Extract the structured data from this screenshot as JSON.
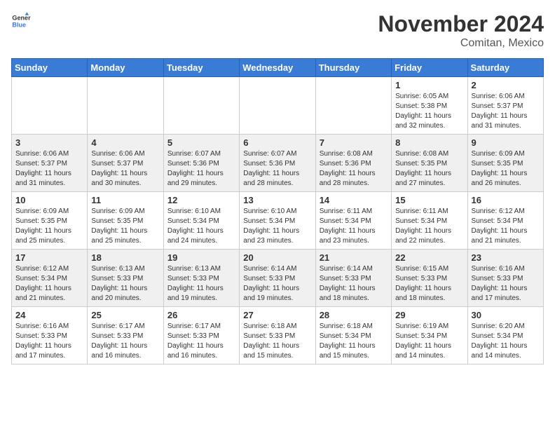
{
  "header": {
    "logo_general": "General",
    "logo_blue": "Blue",
    "month_title": "November 2024",
    "subtitle": "Comitan, Mexico"
  },
  "days_of_week": [
    "Sunday",
    "Monday",
    "Tuesday",
    "Wednesday",
    "Thursday",
    "Friday",
    "Saturday"
  ],
  "weeks": [
    {
      "days": [
        {
          "date": "",
          "info": ""
        },
        {
          "date": "",
          "info": ""
        },
        {
          "date": "",
          "info": ""
        },
        {
          "date": "",
          "info": ""
        },
        {
          "date": "",
          "info": ""
        },
        {
          "date": "1",
          "info": "Sunrise: 6:05 AM\nSunset: 5:38 PM\nDaylight: 11 hours\nand 32 minutes."
        },
        {
          "date": "2",
          "info": "Sunrise: 6:06 AM\nSunset: 5:37 PM\nDaylight: 11 hours\nand 31 minutes."
        }
      ]
    },
    {
      "days": [
        {
          "date": "3",
          "info": "Sunrise: 6:06 AM\nSunset: 5:37 PM\nDaylight: 11 hours\nand 31 minutes."
        },
        {
          "date": "4",
          "info": "Sunrise: 6:06 AM\nSunset: 5:37 PM\nDaylight: 11 hours\nand 30 minutes."
        },
        {
          "date": "5",
          "info": "Sunrise: 6:07 AM\nSunset: 5:36 PM\nDaylight: 11 hours\nand 29 minutes."
        },
        {
          "date": "6",
          "info": "Sunrise: 6:07 AM\nSunset: 5:36 PM\nDaylight: 11 hours\nand 28 minutes."
        },
        {
          "date": "7",
          "info": "Sunrise: 6:08 AM\nSunset: 5:36 PM\nDaylight: 11 hours\nand 28 minutes."
        },
        {
          "date": "8",
          "info": "Sunrise: 6:08 AM\nSunset: 5:35 PM\nDaylight: 11 hours\nand 27 minutes."
        },
        {
          "date": "9",
          "info": "Sunrise: 6:09 AM\nSunset: 5:35 PM\nDaylight: 11 hours\nand 26 minutes."
        }
      ]
    },
    {
      "days": [
        {
          "date": "10",
          "info": "Sunrise: 6:09 AM\nSunset: 5:35 PM\nDaylight: 11 hours\nand 25 minutes."
        },
        {
          "date": "11",
          "info": "Sunrise: 6:09 AM\nSunset: 5:35 PM\nDaylight: 11 hours\nand 25 minutes."
        },
        {
          "date": "12",
          "info": "Sunrise: 6:10 AM\nSunset: 5:34 PM\nDaylight: 11 hours\nand 24 minutes."
        },
        {
          "date": "13",
          "info": "Sunrise: 6:10 AM\nSunset: 5:34 PM\nDaylight: 11 hours\nand 23 minutes."
        },
        {
          "date": "14",
          "info": "Sunrise: 6:11 AM\nSunset: 5:34 PM\nDaylight: 11 hours\nand 23 minutes."
        },
        {
          "date": "15",
          "info": "Sunrise: 6:11 AM\nSunset: 5:34 PM\nDaylight: 11 hours\nand 22 minutes."
        },
        {
          "date": "16",
          "info": "Sunrise: 6:12 AM\nSunset: 5:34 PM\nDaylight: 11 hours\nand 21 minutes."
        }
      ]
    },
    {
      "days": [
        {
          "date": "17",
          "info": "Sunrise: 6:12 AM\nSunset: 5:34 PM\nDaylight: 11 hours\nand 21 minutes."
        },
        {
          "date": "18",
          "info": "Sunrise: 6:13 AM\nSunset: 5:33 PM\nDaylight: 11 hours\nand 20 minutes."
        },
        {
          "date": "19",
          "info": "Sunrise: 6:13 AM\nSunset: 5:33 PM\nDaylight: 11 hours\nand 19 minutes."
        },
        {
          "date": "20",
          "info": "Sunrise: 6:14 AM\nSunset: 5:33 PM\nDaylight: 11 hours\nand 19 minutes."
        },
        {
          "date": "21",
          "info": "Sunrise: 6:14 AM\nSunset: 5:33 PM\nDaylight: 11 hours\nand 18 minutes."
        },
        {
          "date": "22",
          "info": "Sunrise: 6:15 AM\nSunset: 5:33 PM\nDaylight: 11 hours\nand 18 minutes."
        },
        {
          "date": "23",
          "info": "Sunrise: 6:16 AM\nSunset: 5:33 PM\nDaylight: 11 hours\nand 17 minutes."
        }
      ]
    },
    {
      "days": [
        {
          "date": "24",
          "info": "Sunrise: 6:16 AM\nSunset: 5:33 PM\nDaylight: 11 hours\nand 17 minutes."
        },
        {
          "date": "25",
          "info": "Sunrise: 6:17 AM\nSunset: 5:33 PM\nDaylight: 11 hours\nand 16 minutes."
        },
        {
          "date": "26",
          "info": "Sunrise: 6:17 AM\nSunset: 5:33 PM\nDaylight: 11 hours\nand 16 minutes."
        },
        {
          "date": "27",
          "info": "Sunrise: 6:18 AM\nSunset: 5:33 PM\nDaylight: 11 hours\nand 15 minutes."
        },
        {
          "date": "28",
          "info": "Sunrise: 6:18 AM\nSunset: 5:34 PM\nDaylight: 11 hours\nand 15 minutes."
        },
        {
          "date": "29",
          "info": "Sunrise: 6:19 AM\nSunset: 5:34 PM\nDaylight: 11 hours\nand 14 minutes."
        },
        {
          "date": "30",
          "info": "Sunrise: 6:20 AM\nSunset: 5:34 PM\nDaylight: 11 hours\nand 14 minutes."
        }
      ]
    }
  ]
}
